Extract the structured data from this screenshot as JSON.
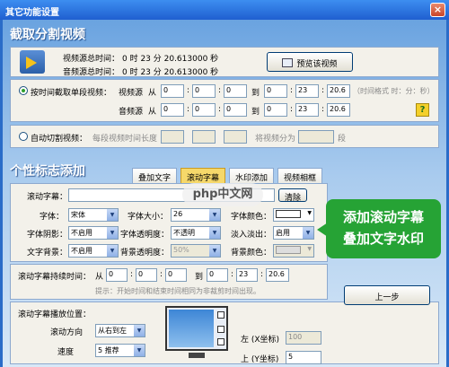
{
  "window": {
    "title": "其它功能设置",
    "close_label": "×"
  },
  "capture": {
    "section_title": "截取分割视频",
    "video_duration_label": "视频源总时间：",
    "audio_duration_label": "音频源总时间：",
    "video_duration": "0   时  23   分 20.613000 秒",
    "audio_duration": "0   时  23   分 20.613000 秒",
    "preview_button": "预览该视频",
    "by_time_label": "按时间截取单段视频：",
    "video_source_label": "视频源",
    "audio_source_label": "音频源",
    "from_label": "从",
    "to_label": "到",
    "from_h": "0",
    "from_m": "0",
    "from_s": "0",
    "to_h": "0",
    "to_m": "23",
    "to_s": "20.6",
    "audio_from_h": "0",
    "audio_from_m": "0",
    "audio_from_s": "0",
    "audio_to_h": "0",
    "audio_to_m": "23",
    "audio_to_s": "20.6",
    "time_format_hint": "（时间格式 时：分：秒）",
    "help_label": "?",
    "auto_split_label": "自动切割视频：",
    "segment_length_label": "每段视频时间长度",
    "split_into_label": "将视频分为",
    "segments_unit": "段",
    "sep": ":"
  },
  "logo": {
    "section_title": "个性标志添加",
    "tabs": [
      "叠加文字",
      "滚动字幕",
      "水印添加",
      "视频相框"
    ],
    "scroll_text_label": "滚动字幕：",
    "scroll_text_value": "",
    "clear_button": "清除",
    "font_label": "字体：",
    "font_value": "宋体",
    "font_size_label": "字体大小：",
    "font_size_value": "26",
    "font_color_label": "字体颜色：",
    "shadow_label": "字体阴影：",
    "shadow_value": "不启用",
    "font_opacity_label": "字体透明度：",
    "font_opacity_value": "不透明",
    "fade_label": "淡入淡出：",
    "fade_value": "启用",
    "bg_label": "文字背景：",
    "bg_value": "不启用",
    "bg_opacity_label": "背景透明度：",
    "bg_opacity_value": "50%",
    "bg_color_label": "背景颜色：",
    "duration_label": "滚动字幕持续时间：",
    "from_label": "从",
    "to_label": "到",
    "d_from_h": "0",
    "d_from_m": "0",
    "d_from_s": "0",
    "d_to_h": "0",
    "d_to_m": "23",
    "d_to_s": "20.6",
    "duration_hint": "提示：开始时间和结束时间相同为非裁剪时间出现。",
    "position_label": "滚动字幕播放位置：",
    "direction_label": "滚动方向",
    "direction_value": "从右到左",
    "speed_label": "速度",
    "speed_value": "5 推荐",
    "left_label": "左 (X坐标)",
    "left_value": "100",
    "top_label": "上 (Y坐标)",
    "top_value": "5",
    "prev_button": "上一步",
    "sep": ":"
  },
  "overlay": {
    "green_line1": "添加滚动字幕",
    "green_line2": "叠加文字水印",
    "watermark_text": "php中文网"
  }
}
